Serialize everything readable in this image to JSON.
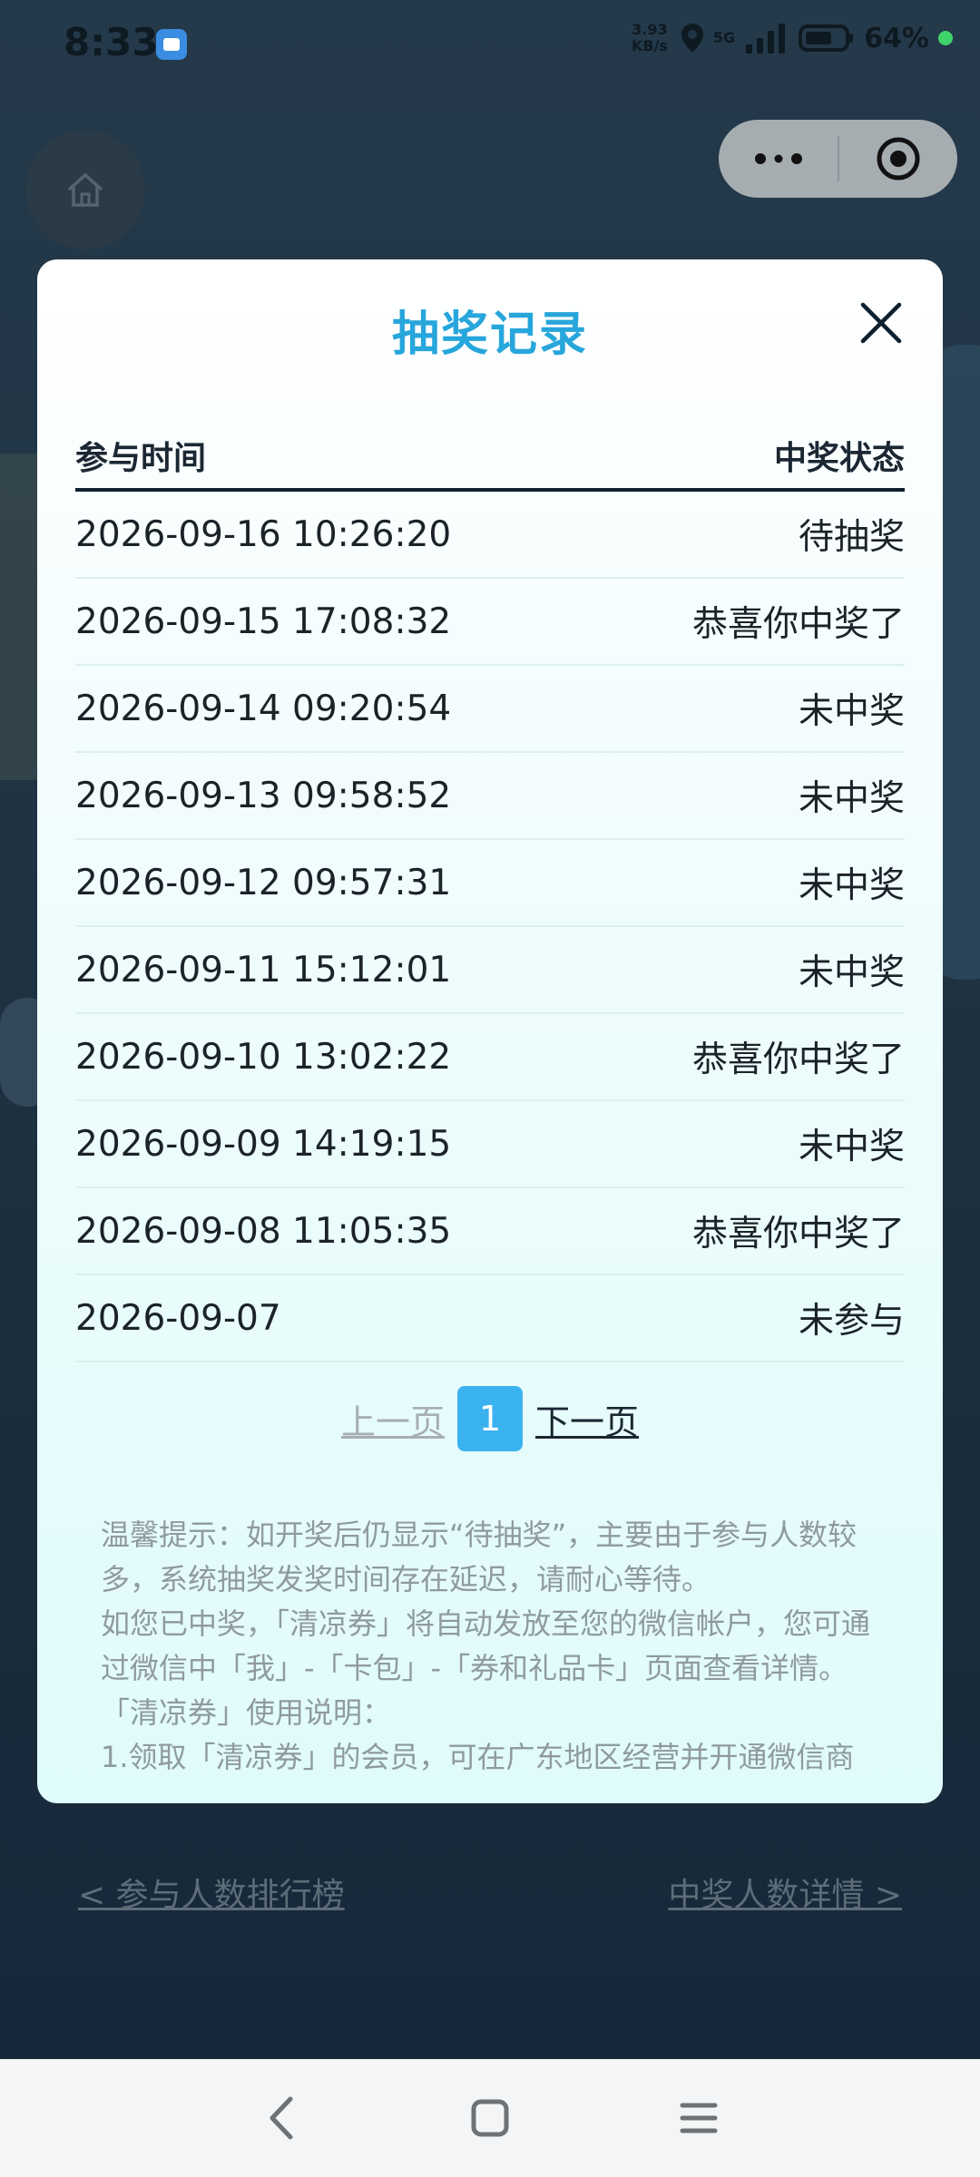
{
  "status_bar": {
    "time": "8:33",
    "net_speed_value": "3.93",
    "net_speed_unit": "KB/s",
    "network": "5G",
    "battery": "64%"
  },
  "modal": {
    "title": "抽奖记录",
    "columns": [
      "参与时间",
      "中奖状态"
    ],
    "rows": [
      {
        "time": "2026-09-16 10:26:20",
        "status": "待抽奖"
      },
      {
        "time": "2026-09-15 17:08:32",
        "status": "恭喜你中奖了"
      },
      {
        "time": "2026-09-14 09:20:54",
        "status": "未中奖"
      },
      {
        "time": "2026-09-13 09:58:52",
        "status": "未中奖"
      },
      {
        "time": "2026-09-12 09:57:31",
        "status": "未中奖"
      },
      {
        "time": "2026-09-11 15:12:01",
        "status": "未中奖"
      },
      {
        "time": "2026-09-10 13:02:22",
        "status": "恭喜你中奖了"
      },
      {
        "time": "2026-09-09 14:19:15",
        "status": "未中奖"
      },
      {
        "time": "2026-09-08 11:05:35",
        "status": "恭喜你中奖了"
      },
      {
        "time": "2026-09-07",
        "status": "未参与"
      }
    ],
    "pagination": {
      "prev_label": "上一页",
      "current_page": "1",
      "next_label": "下一页"
    },
    "tips": [
      "温馨提示：如开奖后仍显示“待抽奖”，主要由于参与人数较多，系统抽奖发奖时间存在延迟，请耐心等待。",
      "如您已中奖，「清凉券」将自动发放至您的微信帐户，您可通过微信中「我」-「卡包」-「券和礼品卡」页面查看详情。",
      "「清凉券」使用说明：",
      "1.领取「清凉券」的会员，可在广东地区经营并开通微信商"
    ]
  },
  "bottom_links": {
    "left": "< 参与人数排行榜",
    "right": "中奖人数详情 >"
  },
  "icons": {
    "home": "home-icon",
    "more": "more-dots-icon",
    "close_miniprogram": "target-close-icon",
    "modal_close": "close-icon",
    "nav_back": "back-icon",
    "nav_home": "square-home-icon",
    "nav_menu": "menu-icon"
  },
  "colors": {
    "title_accent": "#27a6dc",
    "page_active": "#3bb2f0"
  }
}
